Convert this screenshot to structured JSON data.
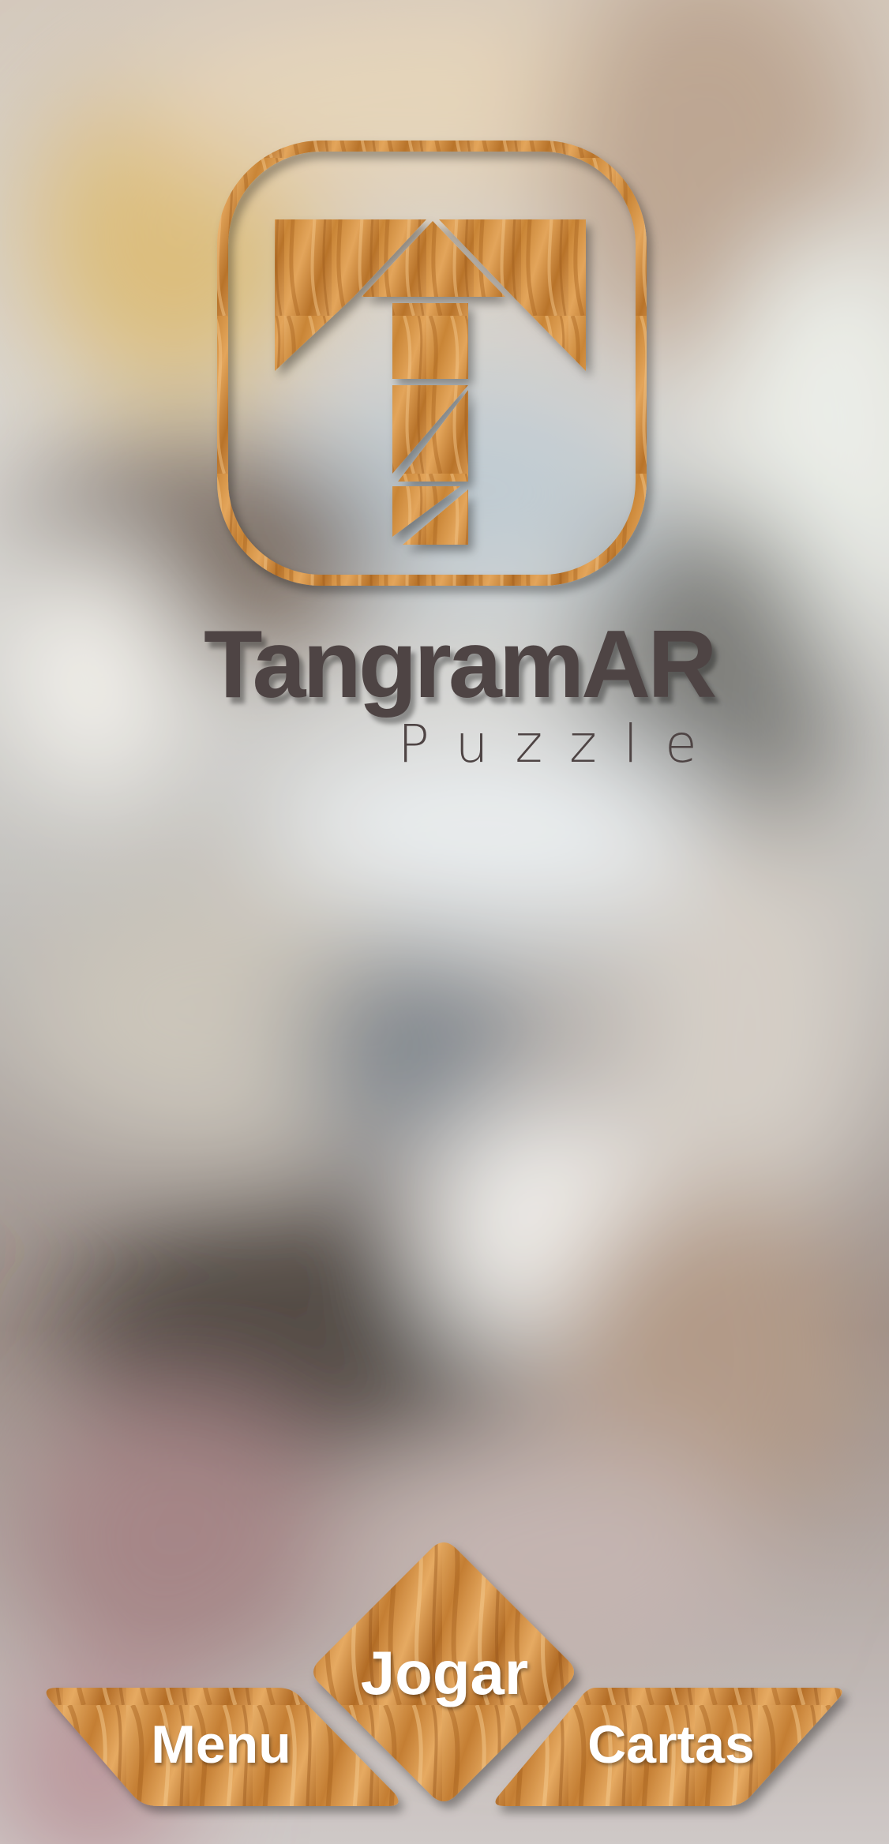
{
  "app": {
    "title": "TangramAR",
    "subtitle": "Puzzle"
  },
  "logo": {
    "icon": "tangram-t-icon"
  },
  "buttons": {
    "play_label": "Jogar",
    "menu_label": "Menu",
    "cards_label": "Cartas"
  },
  "colors": {
    "wood_light": "#e0a35a",
    "wood_dark": "#b26a24",
    "title_text": "#4e4444",
    "button_text": "#ffffff"
  }
}
